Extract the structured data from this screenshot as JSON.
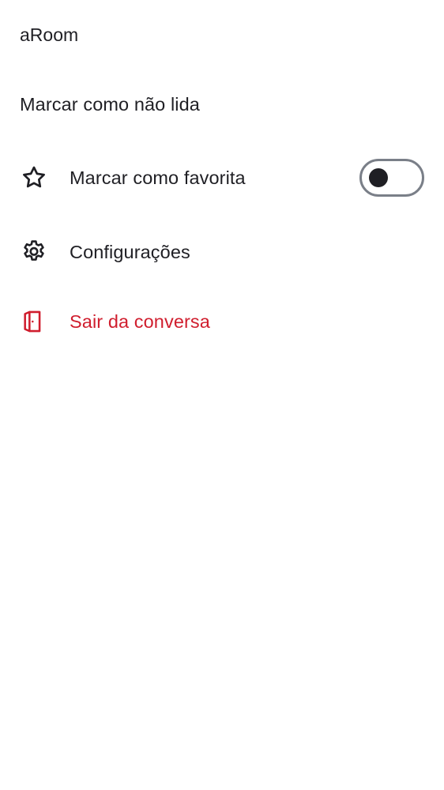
{
  "header": {
    "room_name": "aRoom"
  },
  "menu": {
    "mark_unread": {
      "label": "Marcar como não lida"
    },
    "favorite": {
      "label": "Marcar como favorita",
      "icon": "star-outline-icon",
      "toggle_on": false
    },
    "settings": {
      "label": "Configurações",
      "icon": "gear-icon"
    },
    "leave": {
      "label": "Sair da conversa",
      "icon": "exit-door-icon"
    }
  },
  "colors": {
    "text": "#1f1f24",
    "danger": "#d01e2e",
    "toggle_border": "#7a7f88"
  }
}
